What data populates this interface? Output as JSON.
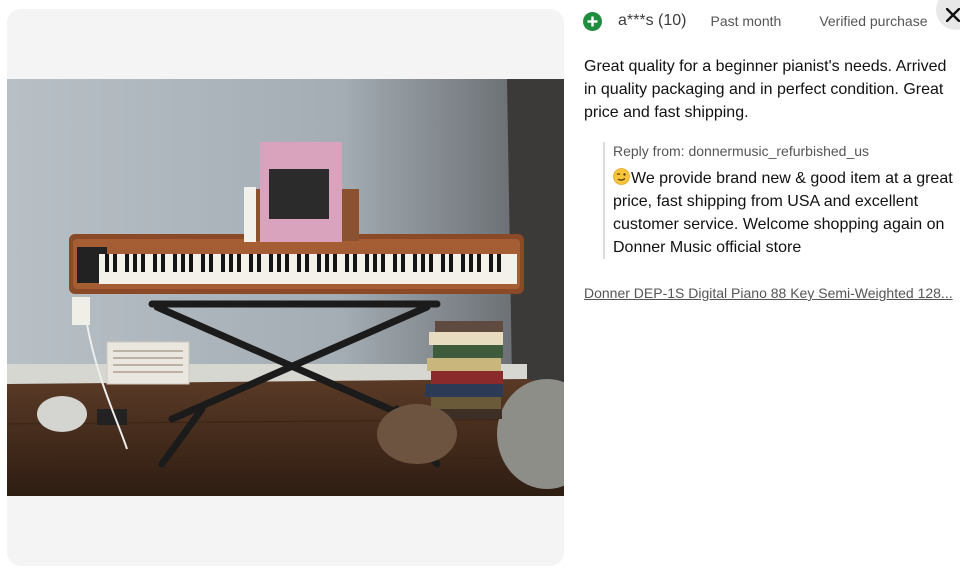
{
  "review": {
    "reviewer": "a***s (10)",
    "date": "Past month",
    "verified": "Verified purchase",
    "body": "Great quality for a beginner pianist's needs. Arrived in quality packaging and in perfect condition. Great price and fast shipping.",
    "reply_label": "Reply from: donnermusic_refurbished_us",
    "reply_text": "We provide brand new & good item at a great price, fast shipping from USA and excellent customer service. Welcome shopping again on Donner Music official store",
    "product_link": "Donner DEP-1S Digital Piano 88 Key Semi-Weighted 128..."
  },
  "icons": {
    "plus": "plus-circle-icon",
    "close": "close-icon",
    "emoji": "winking-face-emoji"
  },
  "colors": {
    "plus_icon": "#1e8e3e",
    "panel_bg": "#f4f4f4"
  }
}
